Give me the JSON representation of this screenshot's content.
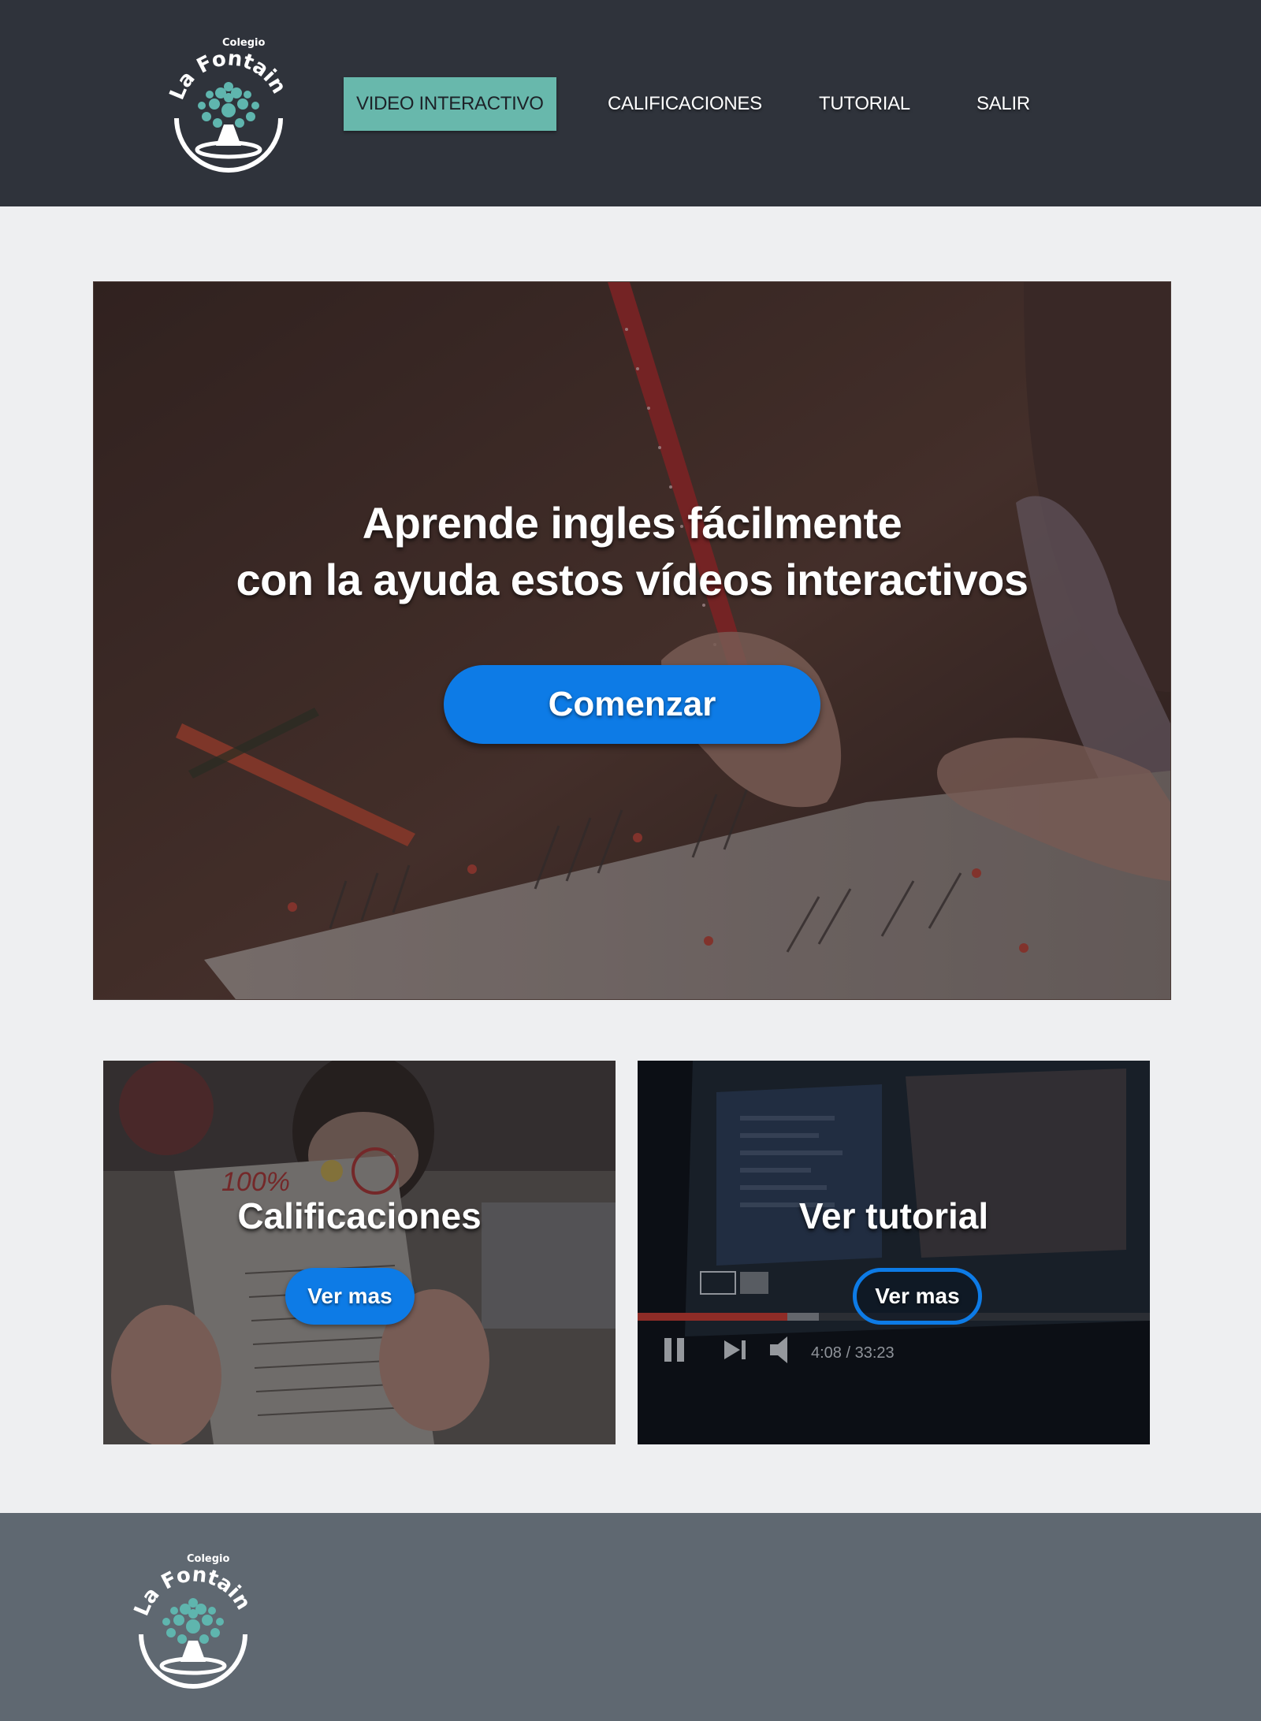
{
  "header": {
    "logo": {
      "top_text": "Colegio",
      "brand": "La Fontaine"
    },
    "nav": [
      {
        "label": "VIDEO INTERACTIVO",
        "active": true
      },
      {
        "label": "CALIFICACIONES"
      },
      {
        "label": "TUTORIAL"
      },
      {
        "label": "SALIR"
      }
    ]
  },
  "hero": {
    "title_line1": "Aprende ingles fácilmente",
    "title_line2": "con la ayuda estos vídeos interactivos",
    "cta_label": "Comenzar"
  },
  "cards": [
    {
      "title": "Calificaciones",
      "button_label": "Ver mas",
      "photo_text": "100%"
    },
    {
      "title": "Ver tutorial",
      "button_label": "Ver mas",
      "player_time": "4:08 / 33:23"
    }
  ],
  "footer": {
    "logo": {
      "top_text": "Colegio",
      "brand": "La Fontaine"
    }
  },
  "colors": {
    "header_bg": "#2f333b",
    "nav_active": "#68b8ac",
    "accent_blue": "#0d7be6",
    "footer_bg": "#5f6871",
    "logo_teal": "#5fb5ae"
  }
}
